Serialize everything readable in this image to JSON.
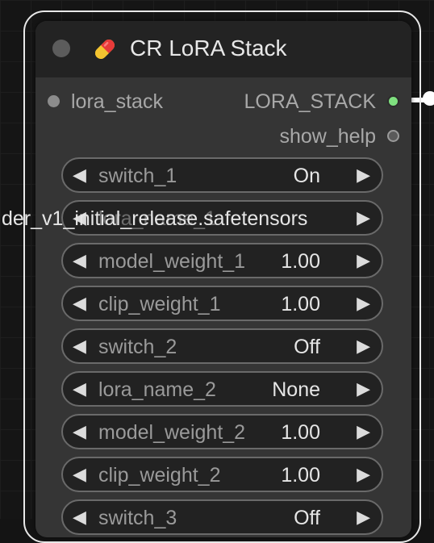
{
  "node": {
    "title": "CR LoRA Stack",
    "title_icon": "pill-icon",
    "inputs": [
      {
        "label": "lora_stack",
        "color": "#8c8c8c"
      }
    ],
    "outputs": [
      {
        "label": "LORA_STACK",
        "color": "#7fe07f"
      },
      {
        "label": "show_help",
        "color": "#8c8c8c"
      }
    ],
    "widgets": [
      {
        "name": "switch_1",
        "value": "On"
      },
      {
        "name": "lora_name_1",
        "value": "der_v1_initial_release.safetensors"
      },
      {
        "name": "model_weight_1",
        "value": "1.00"
      },
      {
        "name": "clip_weight_1",
        "value": "1.00"
      },
      {
        "name": "switch_2",
        "value": "Off"
      },
      {
        "name": "lora_name_2",
        "value": "None"
      },
      {
        "name": "model_weight_2",
        "value": "1.00"
      },
      {
        "name": "clip_weight_2",
        "value": "1.00"
      },
      {
        "name": "switch_3",
        "value": "Off"
      }
    ],
    "arrow_left": "◀",
    "arrow_right": "▶"
  },
  "colors": {
    "node_body": "#353535",
    "node_title": "#232323",
    "widget_bg": "#222222",
    "widget_border": "#6a6a6a",
    "selection_outline": "#e8e8e8",
    "wire": "#ffffff"
  }
}
